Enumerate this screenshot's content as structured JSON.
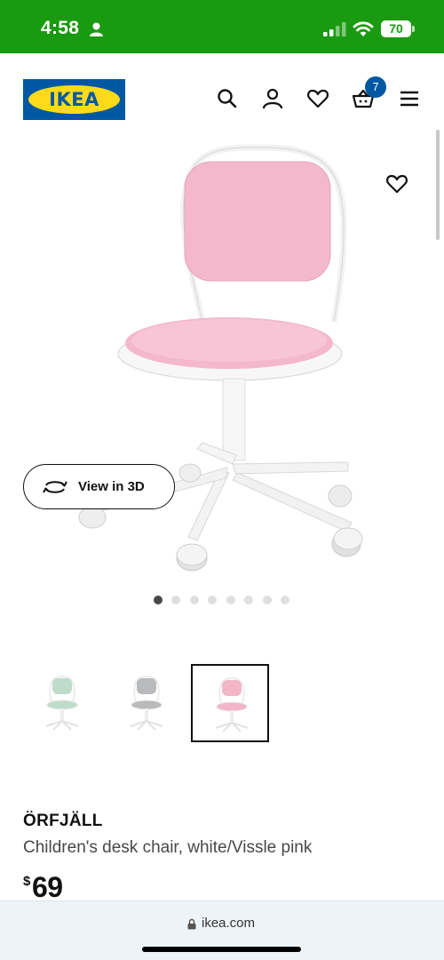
{
  "status_bar": {
    "time": "4:58",
    "battery": "70",
    "background": "#1a9a10"
  },
  "header": {
    "logo_text": "IKEA",
    "cart_count": "7",
    "icons": [
      "search-icon",
      "user-icon",
      "heart-icon",
      "cart-icon",
      "menu-icon"
    ],
    "brand_blue": "#0058a3",
    "brand_yellow": "#ffda1a"
  },
  "gallery": {
    "view_3d_label": "View in 3D",
    "dot_count": 8,
    "active_dot": 1,
    "seat_color": "#f4b8cc"
  },
  "variants": [
    {
      "color": "green",
      "seat": "#bfdccb",
      "selected": false
    },
    {
      "color": "grey",
      "seat": "#b9babc",
      "selected": false
    },
    {
      "color": "pink",
      "seat": "#f3b6c9",
      "selected": true
    }
  ],
  "product": {
    "name": "ÖRFJÄLL",
    "description": "Children's desk chair, white/Vissle pink",
    "currency": "$",
    "price": "69"
  },
  "browser": {
    "url": "ikea.com"
  }
}
